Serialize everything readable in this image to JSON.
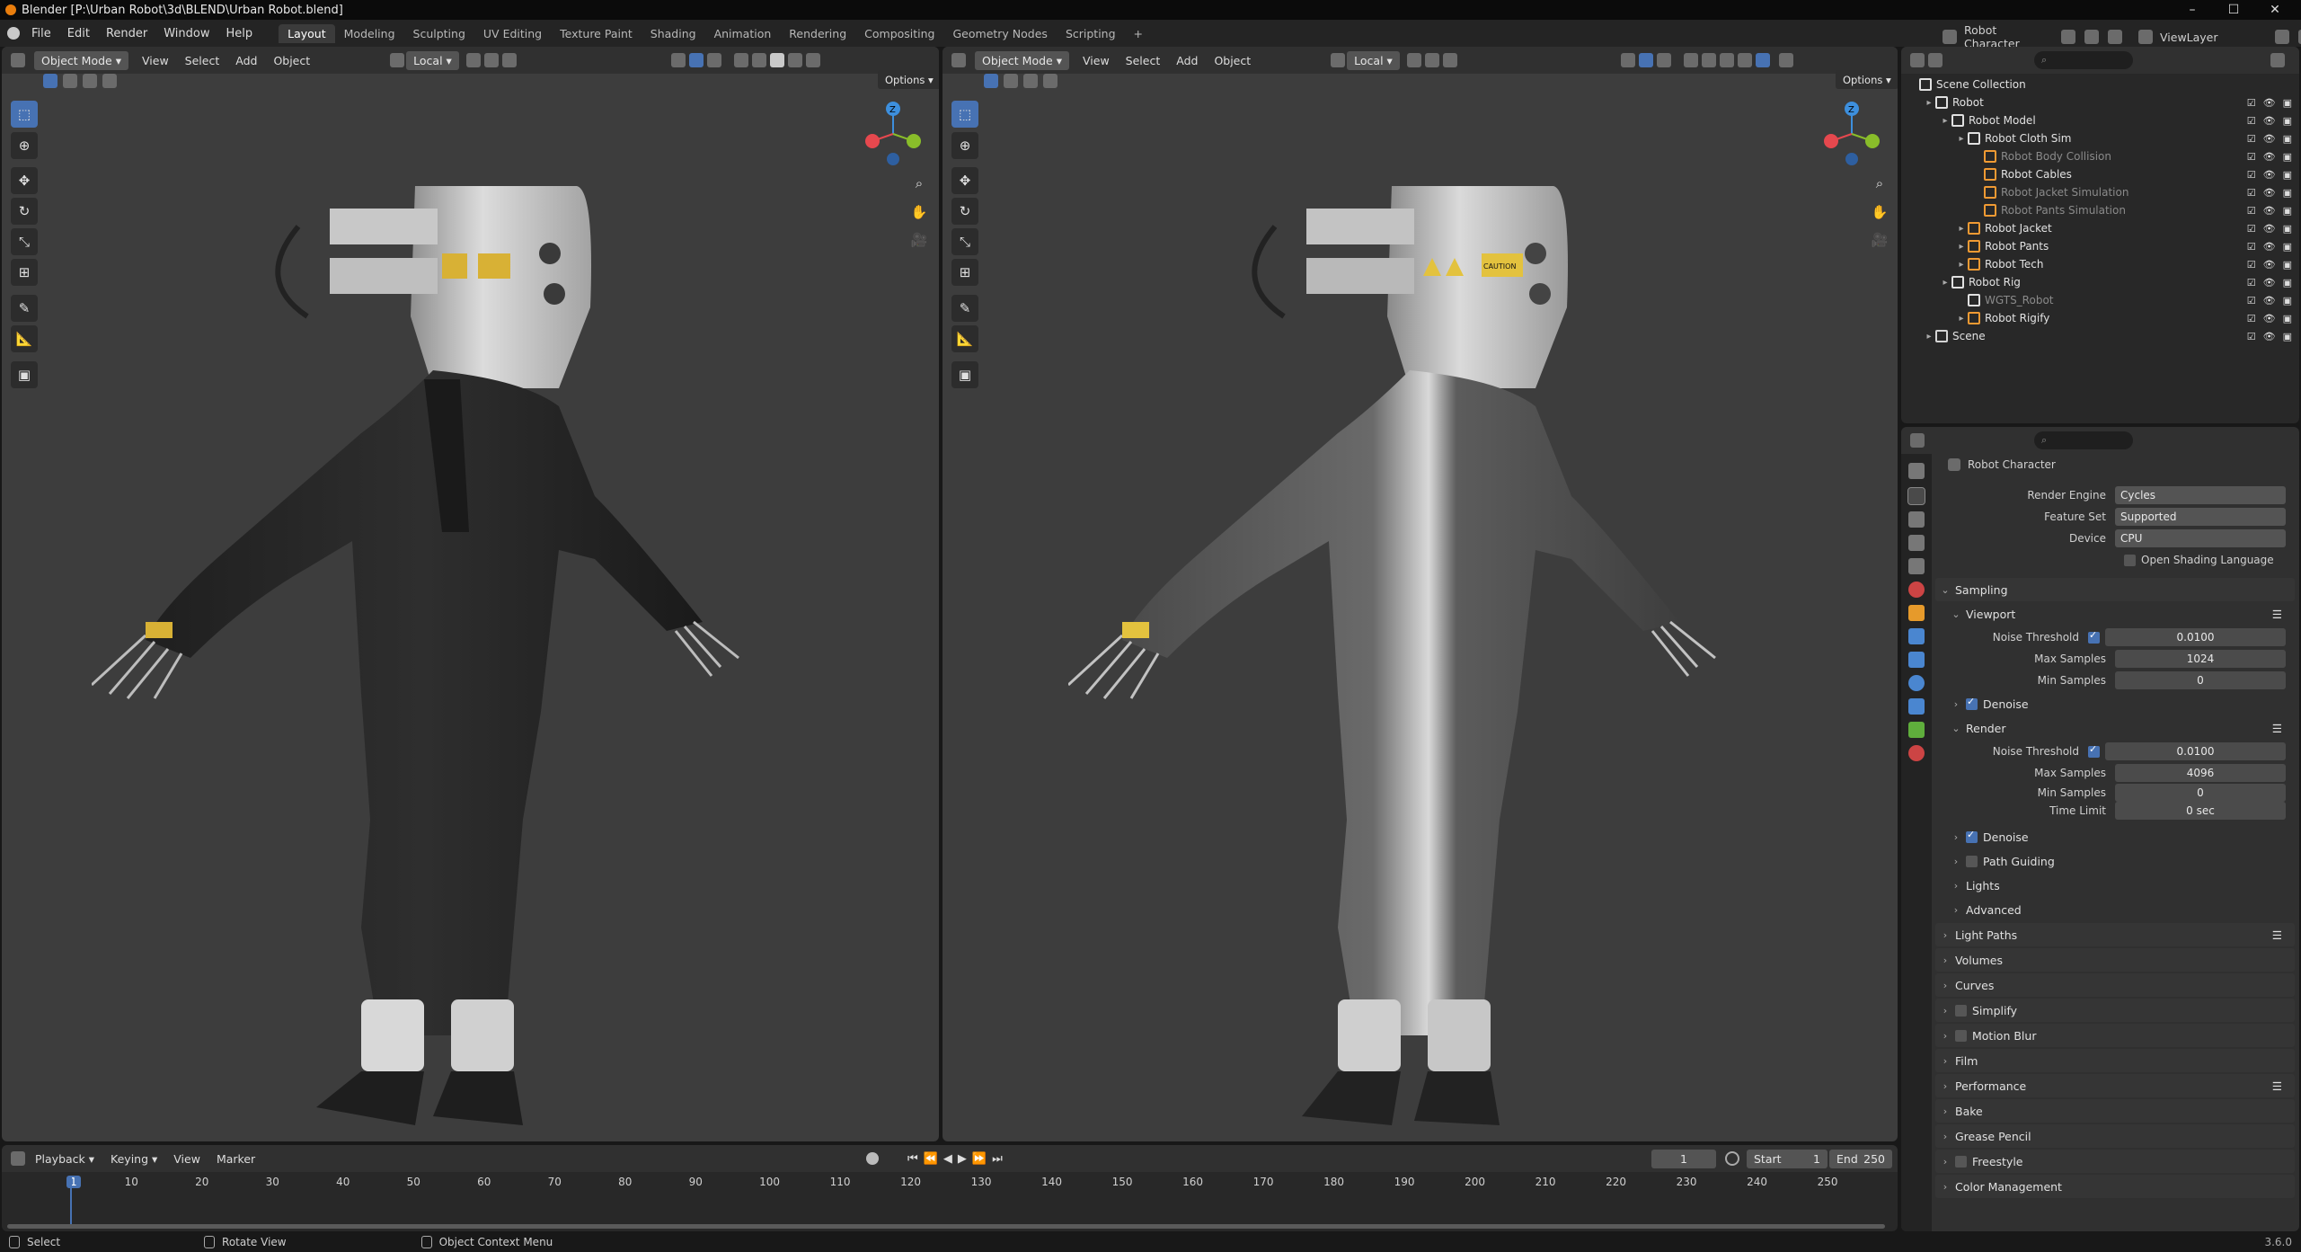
{
  "window": {
    "title": "Blender [P:\\Urban Robot\\3d\\BLEND\\Urban Robot.blend]",
    "minimize": "–",
    "maximize": "☐",
    "close": "✕"
  },
  "menus": [
    "File",
    "Edit",
    "Render",
    "Window",
    "Help"
  ],
  "workspaces": [
    "Layout",
    "Modeling",
    "Sculpting",
    "UV Editing",
    "Texture Paint",
    "Shading",
    "Animation",
    "Rendering",
    "Compositing",
    "Geometry Nodes",
    "Scripting"
  ],
  "active_workspace": "Layout",
  "add_workspace": "+",
  "scene_name": "Robot Character",
  "view_layer": "ViewLayer",
  "viewport_left": {
    "mode": "Object Mode",
    "menus": [
      "View",
      "Select",
      "Add",
      "Object"
    ],
    "transform": "Local",
    "options": "Options"
  },
  "viewport_right": {
    "mode": "Object Mode",
    "menus": [
      "View",
      "Select",
      "Add",
      "Object"
    ],
    "transform": "Local",
    "options": "Options"
  },
  "gizmo_axes": {
    "x": "X",
    "y": "Y",
    "z": "Z"
  },
  "gizmo_colors": {
    "x": "#e6484e",
    "y": "#89bd2a",
    "z": "#3d8fdd"
  },
  "outliner": {
    "search_placeholder": "",
    "rows": [
      {
        "label": "Scene Collection",
        "depth": 0,
        "dim": false,
        "icon": "collection-icon"
      },
      {
        "label": "Robot",
        "depth": 1,
        "dim": false,
        "icon": "collection-icon"
      },
      {
        "label": "Robot Model",
        "depth": 2,
        "dim": false,
        "icon": "collection-icon"
      },
      {
        "label": "Robot Cloth Sim",
        "depth": 3,
        "dim": false,
        "icon": "collection-icon"
      },
      {
        "label": "Robot Body Collision",
        "depth": 4,
        "dim": true,
        "icon": "mesh-icon"
      },
      {
        "label": "Robot Cables",
        "depth": 4,
        "dim": false,
        "icon": "mesh-icon"
      },
      {
        "label": "Robot Jacket Simulation",
        "depth": 4,
        "dim": true,
        "icon": "mesh-icon"
      },
      {
        "label": "Robot Pants Simulation",
        "depth": 4,
        "dim": true,
        "icon": "mesh-icon"
      },
      {
        "label": "Robot Jacket",
        "depth": 3,
        "dim": false,
        "icon": "mesh-icon"
      },
      {
        "label": "Robot Pants",
        "depth": 3,
        "dim": false,
        "icon": "mesh-icon"
      },
      {
        "label": "Robot Tech",
        "depth": 3,
        "dim": false,
        "icon": "mesh-icon"
      },
      {
        "label": "Robot Rig",
        "depth": 2,
        "dim": false,
        "icon": "collection-icon"
      },
      {
        "label": "WGTS_Robot",
        "depth": 3,
        "dim": true,
        "icon": "collection-icon"
      },
      {
        "label": "Robot Rigify",
        "depth": 3,
        "dim": false,
        "icon": "armature-icon"
      },
      {
        "label": "Scene",
        "depth": 1,
        "dim": false,
        "icon": "scene-icon"
      }
    ]
  },
  "properties": {
    "context": "Robot Character",
    "render_engine_label": "Render Engine",
    "render_engine": "Cycles",
    "feature_set_label": "Feature Set",
    "feature_set": "Supported",
    "device_label": "Device",
    "device": "CPU",
    "osl_label": "Open Shading Language",
    "sampling": "Sampling",
    "viewport": "Viewport",
    "noise_threshold_label": "Noise Threshold",
    "vp_noise_threshold": "0.0100",
    "max_samples_label": "Max Samples",
    "vp_max_samples": "1024",
    "min_samples_label": "Min Samples",
    "vp_min_samples": "0",
    "denoise_label": "Denoise",
    "render": "Render",
    "r_noise_threshold": "0.0100",
    "r_max_samples": "4096",
    "r_min_samples": "0",
    "time_limit_label": "Time Limit",
    "r_time_limit": "0 sec",
    "path_guiding": "Path Guiding",
    "lights": "Lights",
    "advanced": "Advanced",
    "panels": [
      "Light Paths",
      "Volumes",
      "Curves",
      "Simplify",
      "Motion Blur",
      "Film",
      "Performance",
      "Bake",
      "Grease Pencil",
      "Freestyle",
      "Color Management"
    ]
  },
  "timeline": {
    "menus": [
      "Playback",
      "Keying",
      "View",
      "Marker"
    ],
    "current_frame": "1",
    "start_label": "Start",
    "start": "1",
    "end_label": "End",
    "end": "250",
    "ticks": [
      "1",
      "10",
      "20",
      "30",
      "40",
      "50",
      "60",
      "70",
      "80",
      "90",
      "100",
      "110",
      "120",
      "130",
      "140",
      "150",
      "160",
      "170",
      "180",
      "190",
      "200",
      "210",
      "220",
      "230",
      "240",
      "250"
    ]
  },
  "statusbar": {
    "select": "Select",
    "rotate": "Rotate View",
    "context_menu": "Object Context Menu",
    "version": "3.6.0"
  },
  "robot_labels": {
    "caution": "CAUTION"
  }
}
